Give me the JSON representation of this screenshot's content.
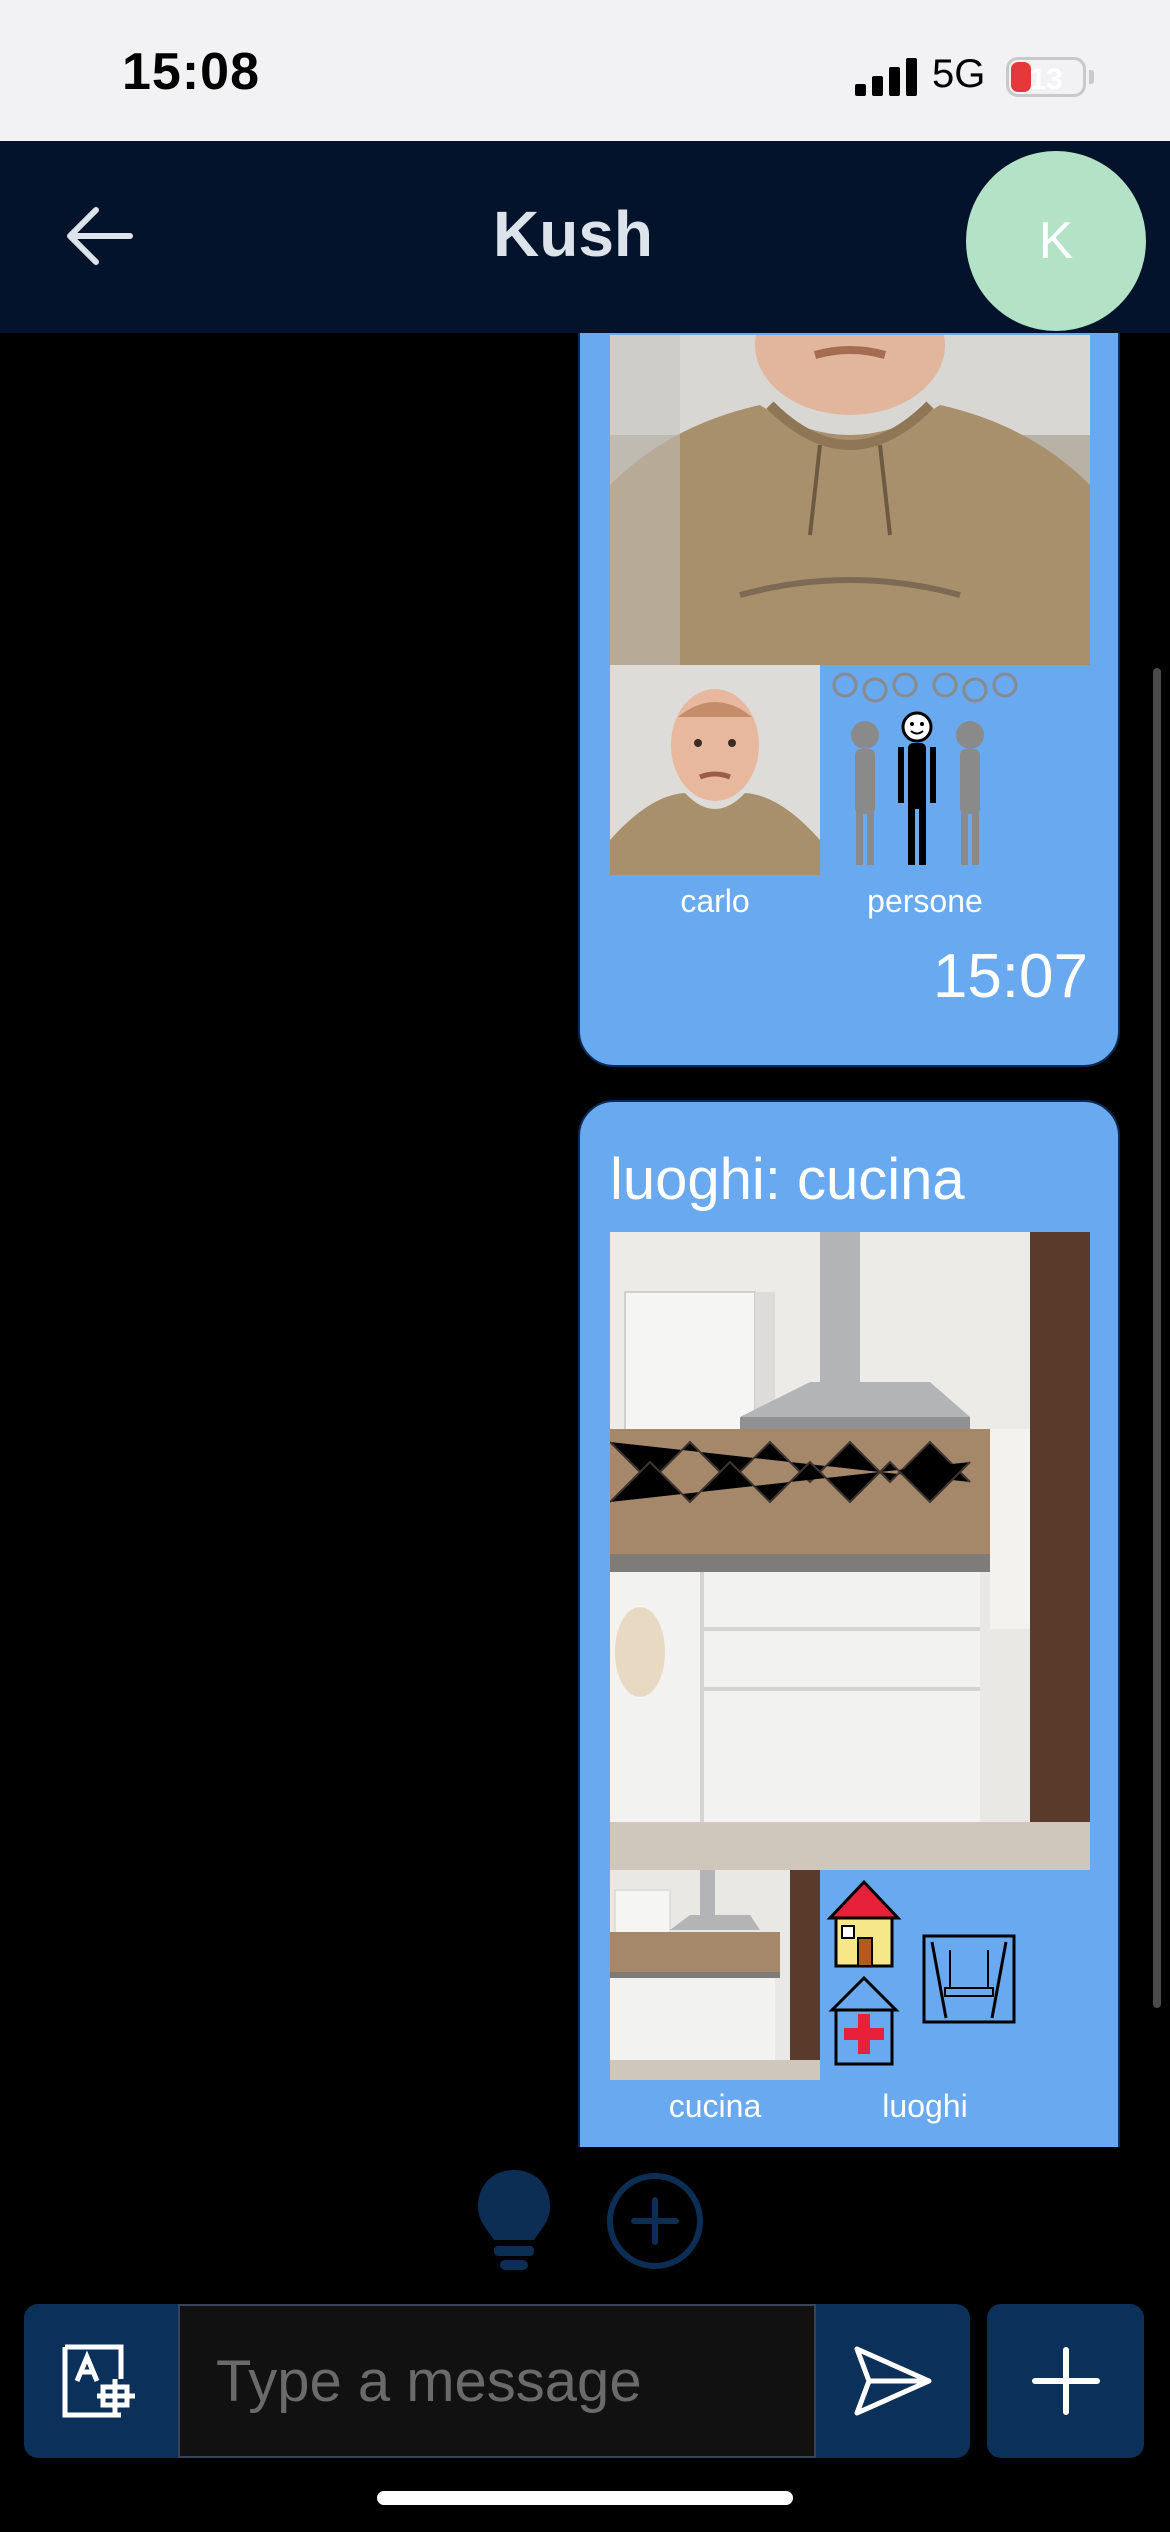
{
  "status_bar": {
    "time": "15:08",
    "network": "5G",
    "battery": "13",
    "battery_level": 0.13
  },
  "header": {
    "title": "Kush",
    "avatar_initial": "K",
    "back_icon": "arrow-left-icon"
  },
  "messages": [
    {
      "thumb_labels": [
        "carlo",
        "persone"
      ],
      "timestamp": "15:07"
    },
    {
      "title": "luoghi: cucina",
      "thumb_labels": [
        "cucina",
        "luoghi"
      ]
    }
  ],
  "composer": {
    "placeholder": "Type a message",
    "translate_icon": "translate-icon",
    "send_icon": "send-icon",
    "add_icon": "plus-icon"
  },
  "tools": {
    "suggest_icon": "lightbulb-icon",
    "add_circle_icon": "plus-circle-icon"
  },
  "colors": {
    "bubble": "#68a9ef",
    "header": "#04132c",
    "accent": "#0b3059",
    "avatar": "#b3e2c6"
  }
}
